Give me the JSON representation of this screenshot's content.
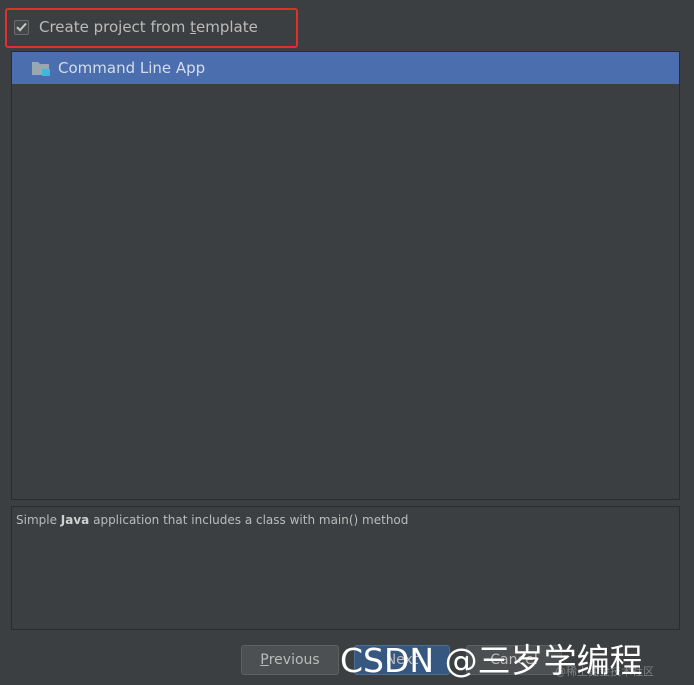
{
  "template_option": {
    "label_pre": "Create project from ",
    "label_mnemonic": "t",
    "label_post": "emplate",
    "checked": true
  },
  "template_list": {
    "items": [
      {
        "label": "Command Line App",
        "icon": "folder-icon",
        "selected": true
      }
    ]
  },
  "description": {
    "prefix": "Simple ",
    "bold": "Java",
    "suffix": " application that includes a class with main() method"
  },
  "buttons": {
    "previous_mnemonic": "P",
    "previous_rest": "revious",
    "next_label": "Next",
    "cancel_label": "Cancel"
  },
  "watermark": {
    "text": "CSDN @三岁学编程",
    "small_text": "@稀土掘金技术社区"
  },
  "colors": {
    "background": "#3c3f41",
    "selection": "#4b6eaf",
    "highlight_border": "#e0302a"
  }
}
